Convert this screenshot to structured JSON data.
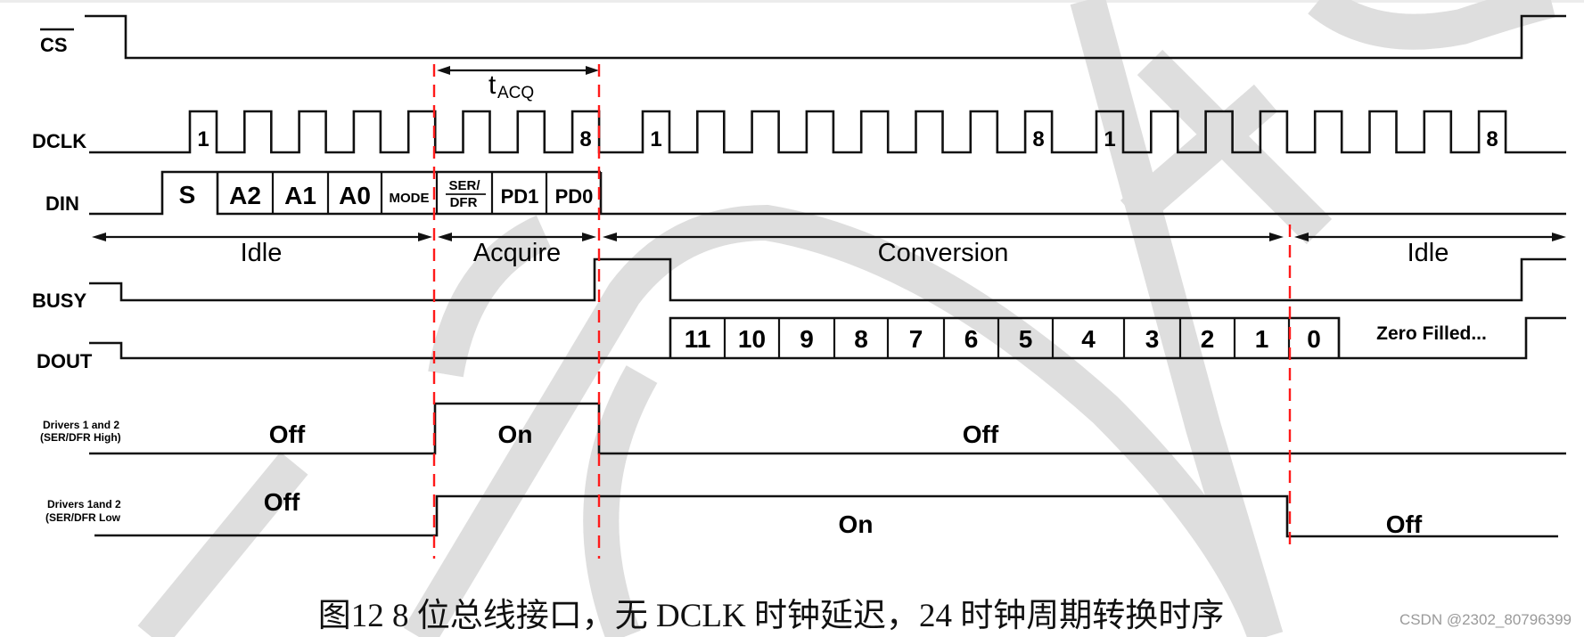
{
  "signals": {
    "cs": "CS",
    "dclk": "DCLK",
    "din": "DIN",
    "busy": "BUSY",
    "dout": "DOUT",
    "drivers_high_line1": "Drivers 1 and 2",
    "drivers_high_line2": "(SER/DFR High)",
    "drivers_low_line1": "Drivers 1and 2",
    "drivers_low_line2": "(SER/DFR Low"
  },
  "timing": {
    "t_acq_main": "t",
    "t_acq_sub": "ACQ",
    "clock_groups": 3,
    "clocks_per_group": 8,
    "pulse_first_label": "1",
    "pulse_last_label": "8"
  },
  "din_cells": [
    "S",
    "A2",
    "A1",
    "A0",
    "MODE",
    "SER/",
    "DFR",
    "PD1",
    "PD0"
  ],
  "phases": {
    "idle1": "Idle",
    "acquire": "Acquire",
    "conversion": "Conversion",
    "idle2": "Idle"
  },
  "dout_cells": [
    "11",
    "10",
    "9",
    "8",
    "7",
    "6",
    "5",
    "4",
    "3",
    "2",
    "1",
    "0"
  ],
  "dout_zero_filled": "Zero Filled...",
  "drivers_high_states": {
    "before": "Off",
    "during": "On",
    "after": "Off"
  },
  "drivers_low_states": {
    "before": "Off",
    "during": "On",
    "after": "Off"
  },
  "caption": "图12 8 位总线接口，无 DCLK 时钟延迟，24 时钟周期转换时序",
  "watermark": "CSDN @2302_80796399",
  "colors": {
    "marker": "#ff1a1a",
    "trace": "#111111",
    "watermark": "#dedede"
  }
}
